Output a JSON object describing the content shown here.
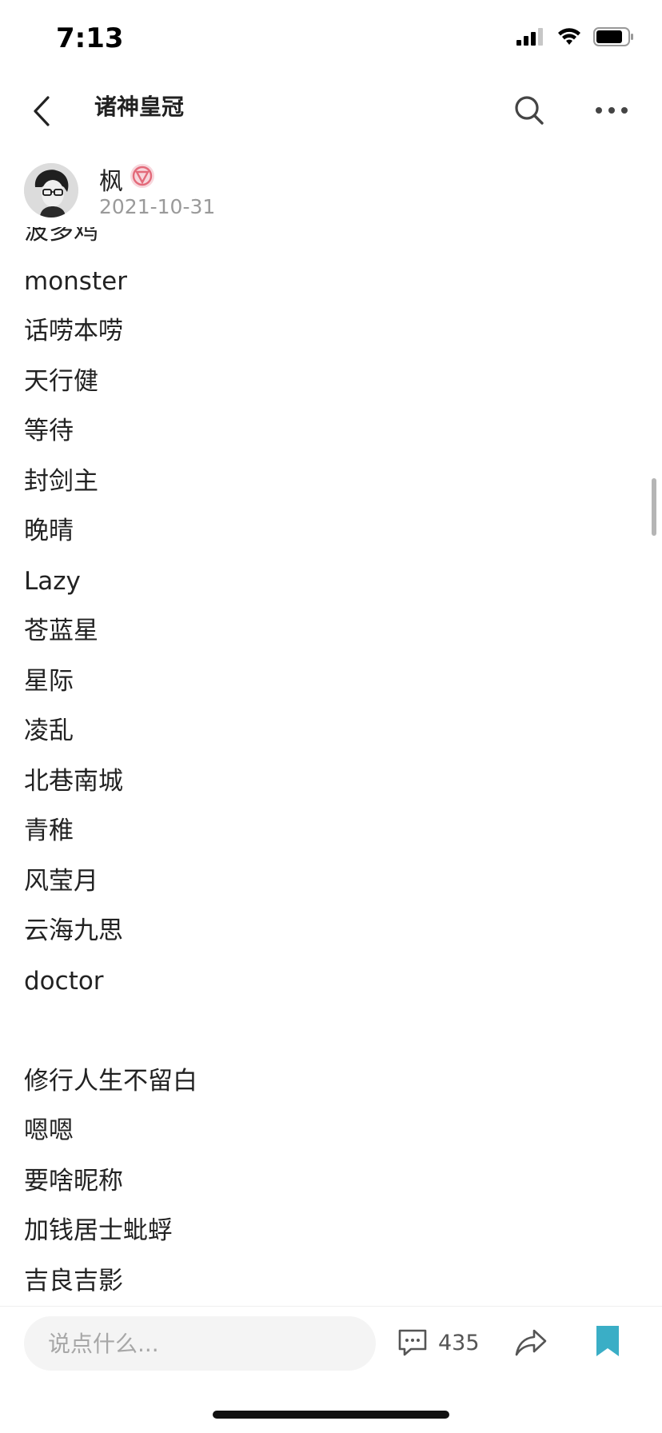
{
  "status_bar": {
    "time": "7:13"
  },
  "nav": {
    "title": "诸神皇冠"
  },
  "author": {
    "name": "枫",
    "date": "2021-10-31"
  },
  "content_lines": [
    "波多鸡",
    "monster",
    "话唠本唠",
    "天行健",
    "等待",
    "封剑主",
    "晚晴",
    "Lazy",
    "苍蓝星",
    "星际",
    "凌乱",
    "北巷南城",
    "青稚",
    "风莹月",
    "云海九思",
    "doctor",
    "",
    "修行人生不留白",
    "嗯嗯",
    "要啥昵称",
    "加钱居士蚍蜉",
    "吉良吉影"
  ],
  "bottom_bar": {
    "comment_placeholder": "说点什么...",
    "comment_count": "435"
  },
  "colors": {
    "bookmark": "#3aaec6",
    "badge": "#e36a7a"
  },
  "icons": [
    "back-icon",
    "search-icon",
    "more-icon",
    "comment-icon",
    "share-icon",
    "bookmark-icon",
    "signal-icon",
    "wifi-icon",
    "battery-icon"
  ]
}
